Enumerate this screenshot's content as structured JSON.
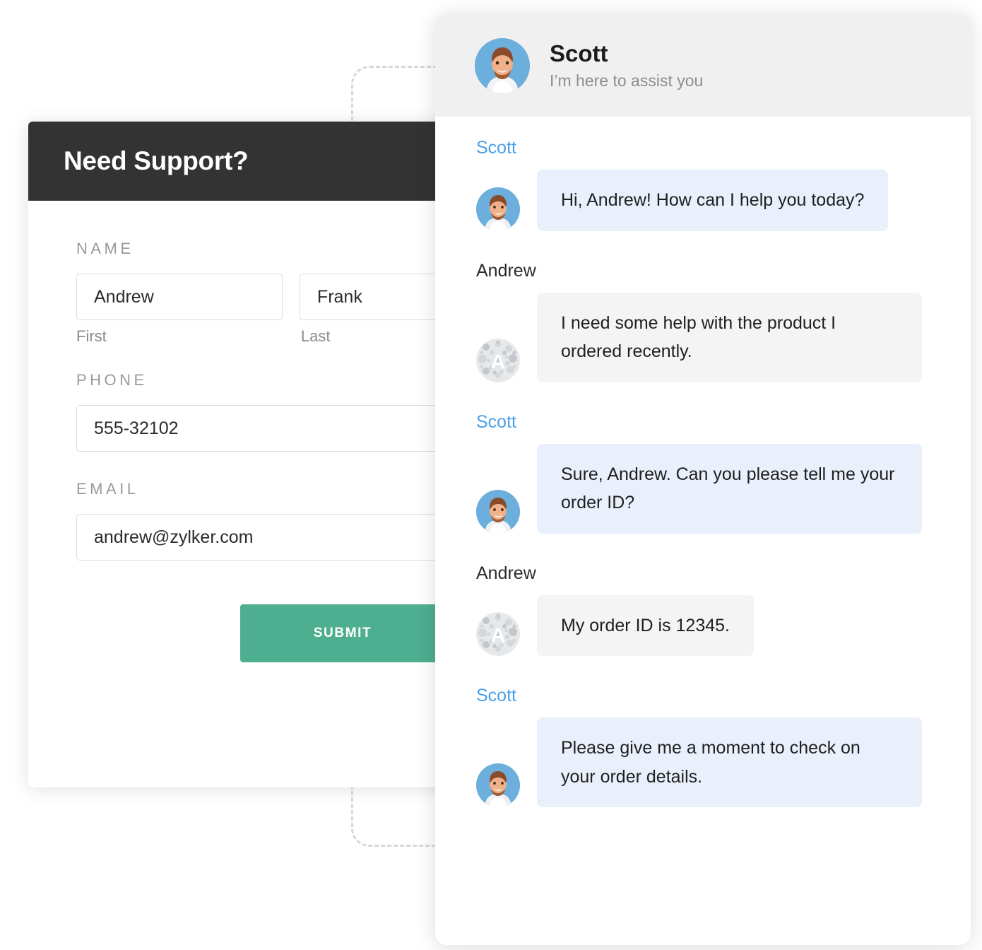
{
  "form": {
    "title": "Need Support?",
    "fields": {
      "name_label": "NAME",
      "first_value": "Andrew",
      "first_caption": "First",
      "last_value": "Frank",
      "last_caption": "Last",
      "phone_label": "PHONE",
      "phone_value": "555-32102",
      "email_label": "EMAIL",
      "email_value": "andrew@zylker.com"
    },
    "submit_label": "SUBMIT",
    "colors": {
      "header_bg": "#333333",
      "submit_bg": "#4EAE90"
    }
  },
  "chat": {
    "header": {
      "agent_name": "Scott",
      "agent_tagline": "I’m here to assist you",
      "avatar_alt": "agent-photo-avatar"
    },
    "colors": {
      "agent_name_color": "#4A9FE8",
      "agent_bubble_bg": "#E9F0FB",
      "user_bubble_bg": "#F4F4F4",
      "header_bg": "#F0F0F0"
    },
    "messages": [
      {
        "sender": "Scott",
        "role": "agent",
        "text": "Hi, Andrew! How can I help you today?",
        "avatar": "agent-photo-avatar"
      },
      {
        "sender": "Andrew",
        "role": "user",
        "text": "I need some help with the product I ordered recently.",
        "avatar": "user-initial-avatar",
        "avatar_initial": "A"
      },
      {
        "sender": "Scott",
        "role": "agent",
        "text": "Sure, Andrew. Can you please tell me your order ID?",
        "avatar": "agent-photo-avatar"
      },
      {
        "sender": "Andrew",
        "role": "user",
        "text": "My order ID is 12345.",
        "avatar": "user-initial-avatar",
        "avatar_initial": "A"
      },
      {
        "sender": "Scott",
        "role": "agent",
        "text": "Please give me a moment to check on your order details.",
        "avatar": "agent-photo-avatar"
      }
    ]
  }
}
